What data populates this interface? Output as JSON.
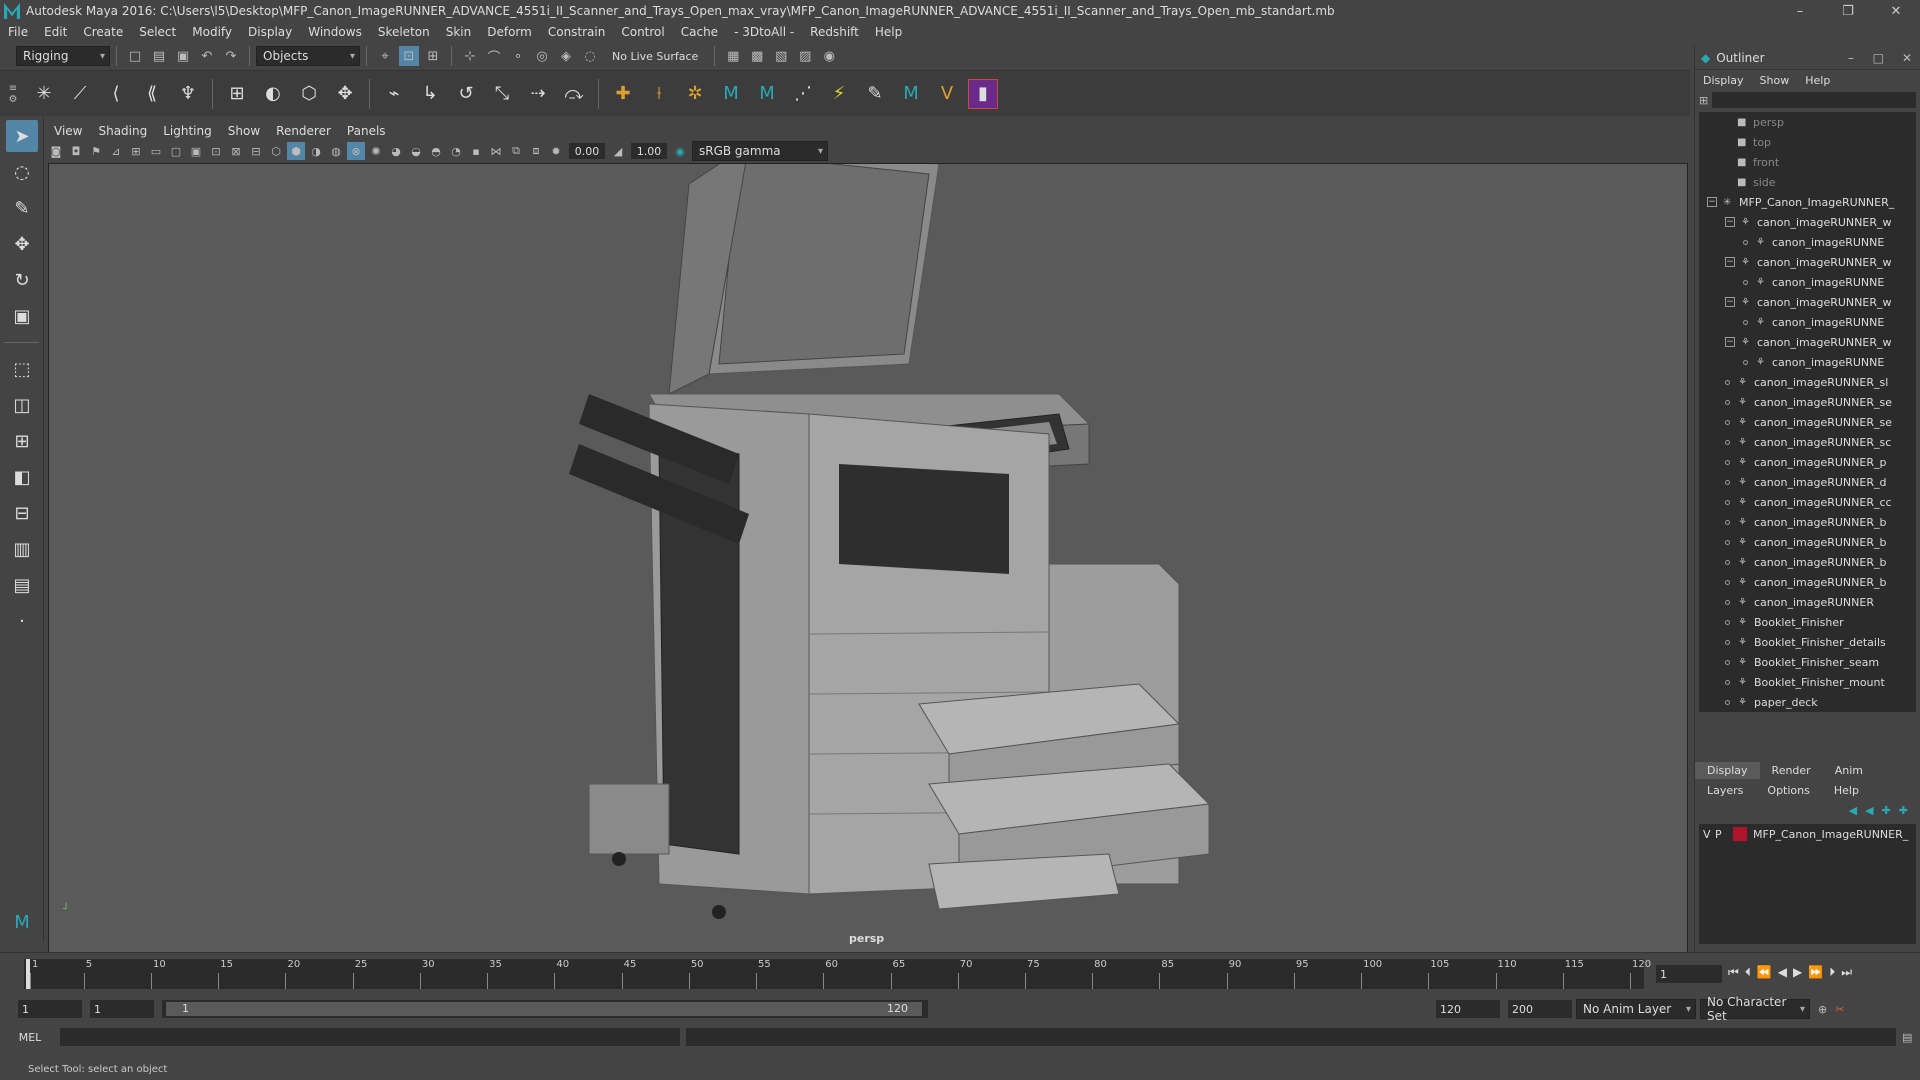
{
  "window": {
    "title": "Autodesk Maya 2016: C:\\Users\\l5\\Desktop\\MFP_Canon_ImageRUNNER_ADVANCE_4551i_II_Scanner_and_Trays_Open_max_vray\\MFP_Canon_ImageRUNNER_ADVANCE_4551i_II_Scanner_and_Trays_Open_mb_standart.mb"
  },
  "menus": [
    "File",
    "Edit",
    "Create",
    "Select",
    "Modify",
    "Display",
    "Windows",
    "Skeleton",
    "Skin",
    "Deform",
    "Constrain",
    "Control",
    "Cache",
    "- 3DtoAll -",
    "Redshift",
    "Help"
  ],
  "toolbar": {
    "mode": "Rigging",
    "objects": "Objects",
    "live_surface": "No Live Surface"
  },
  "viewport": {
    "menus": [
      "View",
      "Shading",
      "Lighting",
      "Show",
      "Renderer",
      "Panels"
    ],
    "field1": "0.00",
    "field2": "1.00",
    "color_space": "sRGB gamma",
    "camera_label": "persp"
  },
  "outliner": {
    "title": "Outliner",
    "menus": [
      "Display",
      "Show",
      "Help"
    ],
    "items": [
      {
        "label": "persp",
        "type": "camera",
        "indent": 0,
        "dim": true
      },
      {
        "label": "top",
        "type": "camera",
        "indent": 0,
        "dim": true
      },
      {
        "label": "front",
        "type": "camera",
        "indent": 0,
        "dim": true
      },
      {
        "label": "side",
        "type": "camera",
        "indent": 0,
        "dim": true
      },
      {
        "label": "MFP_Canon_ImageRUNNER_",
        "type": "group",
        "indent": 0,
        "expanded": true
      },
      {
        "label": "canon_imageRUNNER_w",
        "type": "mesh",
        "indent": 1,
        "expanded": true
      },
      {
        "label": "canon_imageRUNNE",
        "type": "mesh",
        "indent": 2
      },
      {
        "label": "canon_imageRUNNER_w",
        "type": "mesh",
        "indent": 1,
        "expanded": true
      },
      {
        "label": "canon_imageRUNNE",
        "type": "mesh",
        "indent": 2
      },
      {
        "label": "canon_imageRUNNER_w",
        "type": "mesh",
        "indent": 1,
        "expanded": true
      },
      {
        "label": "canon_imageRUNNE",
        "type": "mesh",
        "indent": 2
      },
      {
        "label": "canon_imageRUNNER_w",
        "type": "mesh",
        "indent": 1,
        "expanded": true
      },
      {
        "label": "canon_imageRUNNE",
        "type": "mesh",
        "indent": 2
      },
      {
        "label": "canon_imageRUNNER_sl",
        "type": "mesh",
        "indent": 1
      },
      {
        "label": "canon_imageRUNNER_se",
        "type": "mesh",
        "indent": 1
      },
      {
        "label": "canon_imageRUNNER_se",
        "type": "mesh",
        "indent": 1
      },
      {
        "label": "canon_imageRUNNER_sc",
        "type": "mesh",
        "indent": 1
      },
      {
        "label": "canon_imageRUNNER_p",
        "type": "mesh",
        "indent": 1
      },
      {
        "label": "canon_imageRUNNER_d",
        "type": "mesh",
        "indent": 1
      },
      {
        "label": "canon_imageRUNNER_cc",
        "type": "mesh",
        "indent": 1
      },
      {
        "label": "canon_imageRUNNER_b",
        "type": "mesh",
        "indent": 1
      },
      {
        "label": "canon_imageRUNNER_b",
        "type": "mesh",
        "indent": 1
      },
      {
        "label": "canon_imageRUNNER_b",
        "type": "mesh",
        "indent": 1
      },
      {
        "label": "canon_imageRUNNER_b",
        "type": "mesh",
        "indent": 1
      },
      {
        "label": "canon_imageRUNNER",
        "type": "mesh",
        "indent": 1
      },
      {
        "label": "Booklet_Finisher",
        "type": "mesh",
        "indent": 1
      },
      {
        "label": "Booklet_Finisher_details",
        "type": "mesh",
        "indent": 1
      },
      {
        "label": "Booklet_Finisher_seam",
        "type": "mesh",
        "indent": 1
      },
      {
        "label": "Booklet_Finisher_mount",
        "type": "mesh",
        "indent": 1
      },
      {
        "label": "paper_deck",
        "type": "mesh",
        "indent": 1
      }
    ]
  },
  "layers": {
    "tabs": [
      "Display",
      "Render",
      "Anim"
    ],
    "menus": [
      "Layers",
      "Options",
      "Help"
    ],
    "layer": {
      "v": "V",
      "p": "P",
      "name": "MFP_Canon_ImageRUNNER_",
      "color": "#b0142a"
    }
  },
  "timeline": {
    "ticks": [
      "1",
      "5",
      "10",
      "15",
      "20",
      "25",
      "30",
      "35",
      "40",
      "45",
      "50",
      "55",
      "60",
      "65",
      "70",
      "75",
      "80",
      "85",
      "90",
      "95",
      "100",
      "105",
      "110",
      "115",
      "120"
    ],
    "current_frame": "1"
  },
  "range": {
    "start": "1",
    "current": "1",
    "range_start": "1",
    "range_end": "120",
    "end": "120",
    "max": "200",
    "anim_layer": "No Anim Layer",
    "char_set": "No Character Set"
  },
  "cmdline": {
    "label": "MEL"
  },
  "status": {
    "text": "Select Tool: select an object"
  },
  "colors": {
    "accent": "#5285a6",
    "layer": "#b0142a",
    "bg": "#444444"
  }
}
